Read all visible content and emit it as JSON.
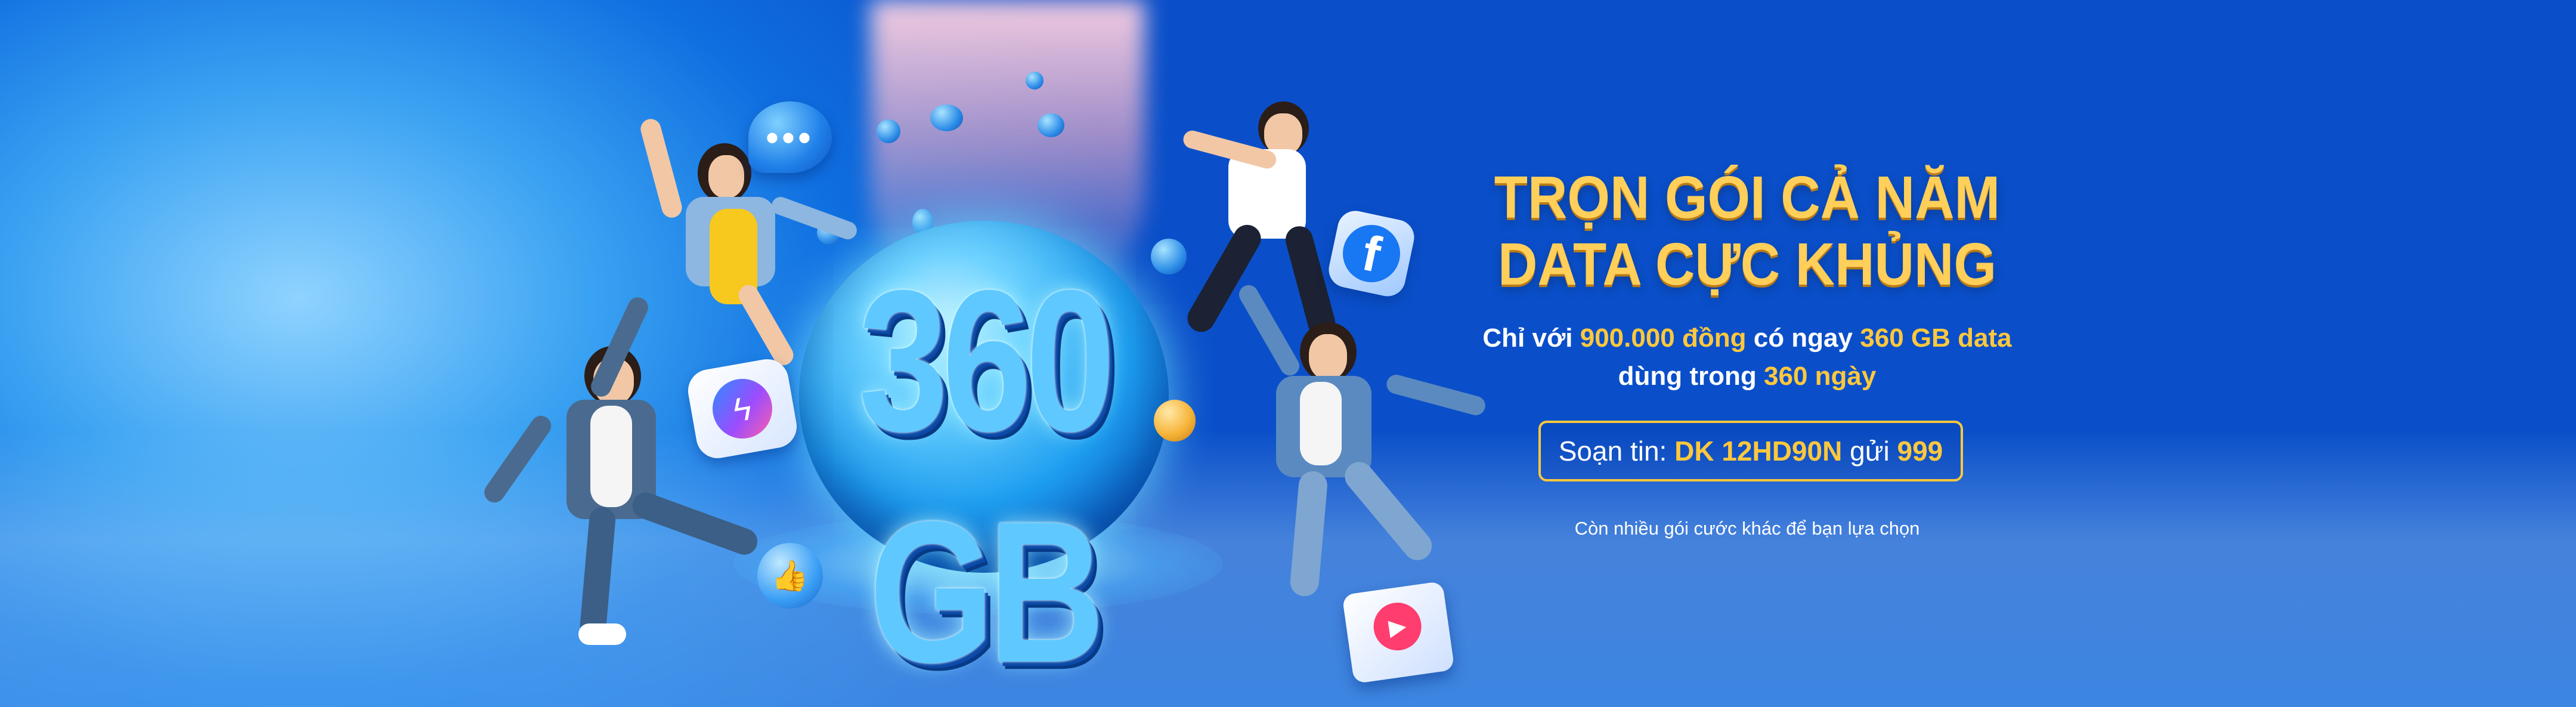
{
  "banner": {
    "headline_line1": "TRỌN GÓI CẢ NĂM",
    "headline_line2": "DATA CỰC KHỦNG",
    "orb_text": "360 GB",
    "sub_line1": {
      "prefix": "Chỉ với",
      "price": "900.000 đồng",
      "middle": "có ngay",
      "data": "360 GB data"
    },
    "sub_line2": {
      "prefix": "dùng trong",
      "days": "360 ngày"
    },
    "cta": {
      "prefix": "Soạn tin:",
      "code": "DK 12HD90N",
      "middle": "gửi",
      "number": "999"
    },
    "more_text": "Còn nhiều gói cước khác để bạn lựa chọn"
  },
  "icons": {
    "chat": "chat-bubble-icon",
    "facebook": "facebook-icon",
    "messenger": "messenger-icon",
    "like": "like-icon",
    "play": "video-play-icon"
  },
  "colors": {
    "accent_gold": "#ffc83d",
    "background_blue": "#0d63dc"
  }
}
